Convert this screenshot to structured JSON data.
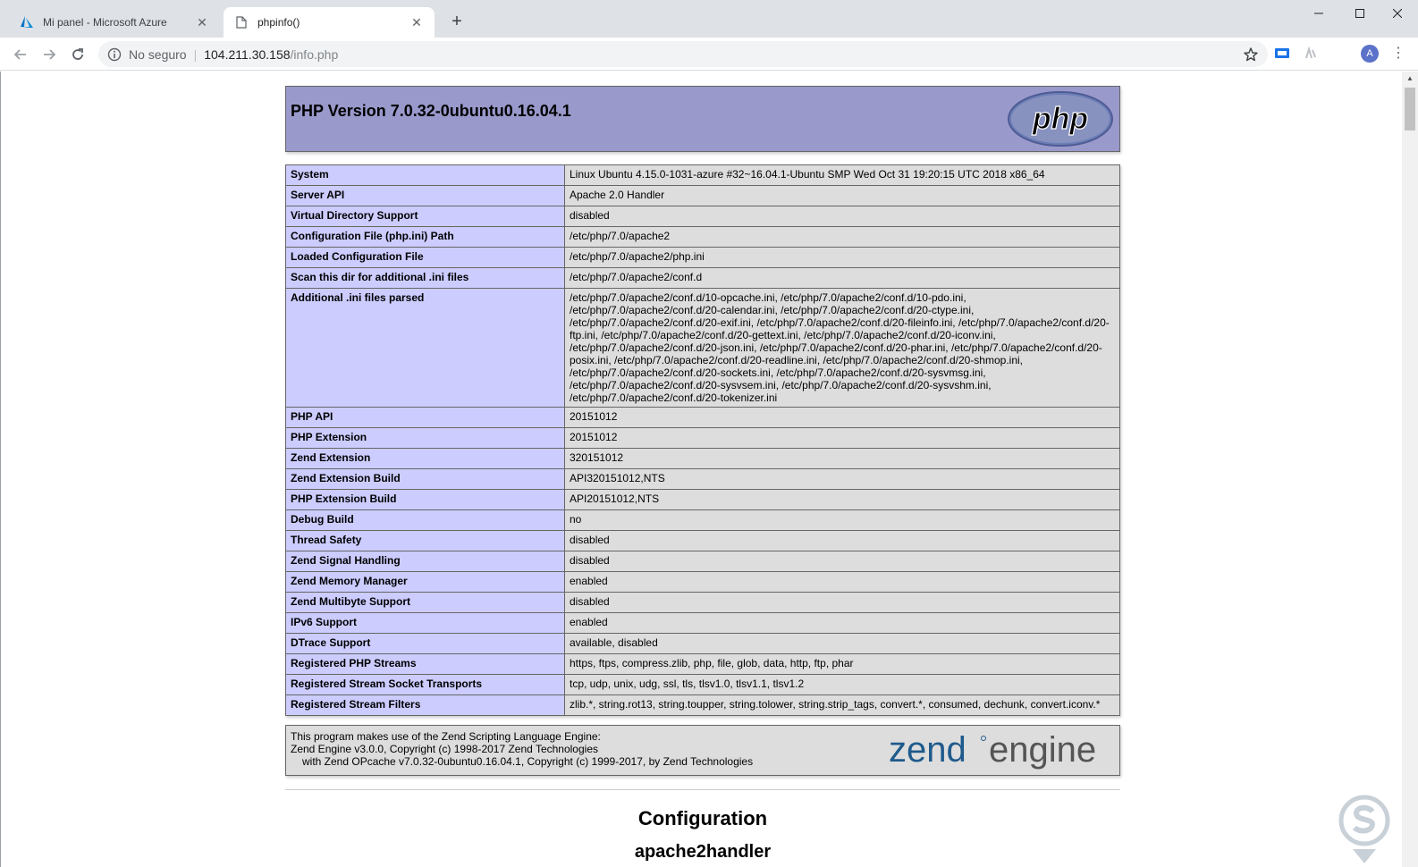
{
  "browser": {
    "tabs": [
      {
        "title": "Mi panel - Microsoft Azure",
        "icon": "azure-icon",
        "active": false
      },
      {
        "title": "phpinfo()",
        "icon": "page-icon",
        "active": true
      }
    ],
    "address": {
      "security": "No seguro",
      "host": "104.211.30.158",
      "path": "/info.php"
    },
    "avatar_letter": "A"
  },
  "php": {
    "version_title": "PHP Version 7.0.32-0ubuntu0.16.04.1",
    "logo_text": "php",
    "rows": [
      {
        "key": "System",
        "value": "Linux Ubuntu 4.15.0-1031-azure #32~16.04.1-Ubuntu SMP Wed Oct 31 19:20:15 UTC 2018 x86_64"
      },
      {
        "key": "Server API",
        "value": "Apache 2.0 Handler"
      },
      {
        "key": "Virtual Directory Support",
        "value": "disabled"
      },
      {
        "key": "Configuration File (php.ini) Path",
        "value": "/etc/php/7.0/apache2"
      },
      {
        "key": "Loaded Configuration File",
        "value": "/etc/php/7.0/apache2/php.ini"
      },
      {
        "key": "Scan this dir for additional .ini files",
        "value": "/etc/php/7.0/apache2/conf.d"
      },
      {
        "key": "Additional .ini files parsed",
        "value": "/etc/php/7.0/apache2/conf.d/10-opcache.ini, /etc/php/7.0/apache2/conf.d/10-pdo.ini, /etc/php/7.0/apache2/conf.d/20-calendar.ini, /etc/php/7.0/apache2/conf.d/20-ctype.ini, /etc/php/7.0/apache2/conf.d/20-exif.ini, /etc/php/7.0/apache2/conf.d/20-fileinfo.ini, /etc/php/7.0/apache2/conf.d/20-ftp.ini, /etc/php/7.0/apache2/conf.d/20-gettext.ini, /etc/php/7.0/apache2/conf.d/20-iconv.ini, /etc/php/7.0/apache2/conf.d/20-json.ini, /etc/php/7.0/apache2/conf.d/20-phar.ini, /etc/php/7.0/apache2/conf.d/20-posix.ini, /etc/php/7.0/apache2/conf.d/20-readline.ini, /etc/php/7.0/apache2/conf.d/20-shmop.ini, /etc/php/7.0/apache2/conf.d/20-sockets.ini, /etc/php/7.0/apache2/conf.d/20-sysvmsg.ini, /etc/php/7.0/apache2/conf.d/20-sysvsem.ini, /etc/php/7.0/apache2/conf.d/20-sysvshm.ini, /etc/php/7.0/apache2/conf.d/20-tokenizer.ini"
      },
      {
        "key": "PHP API",
        "value": "20151012"
      },
      {
        "key": "PHP Extension",
        "value": "20151012"
      },
      {
        "key": "Zend Extension",
        "value": "320151012"
      },
      {
        "key": "Zend Extension Build",
        "value": "API320151012,NTS"
      },
      {
        "key": "PHP Extension Build",
        "value": "API20151012,NTS"
      },
      {
        "key": "Debug Build",
        "value": "no"
      },
      {
        "key": "Thread Safety",
        "value": "disabled"
      },
      {
        "key": "Zend Signal Handling",
        "value": "disabled"
      },
      {
        "key": "Zend Memory Manager",
        "value": "enabled"
      },
      {
        "key": "Zend Multibyte Support",
        "value": "disabled"
      },
      {
        "key": "IPv6 Support",
        "value": "enabled"
      },
      {
        "key": "DTrace Support",
        "value": "available, disabled"
      },
      {
        "key": "Registered PHP Streams",
        "value": "https, ftps, compress.zlib, php, file, glob, data, http, ftp, phar"
      },
      {
        "key": "Registered Stream Socket Transports",
        "value": "tcp, udp, unix, udg, ssl, tls, tlsv1.0, tlsv1.1, tlsv1.2"
      },
      {
        "key": "Registered Stream Filters",
        "value": "zlib.*, string.rot13, string.toupper, string.tolower, string.strip_tags, convert.*, consumed, dechunk, convert.iconv.*"
      }
    ],
    "zend": {
      "line1": "This program makes use of the Zend Scripting Language Engine:",
      "line2": "Zend Engine v3.0.0, Copyright (c) 1998-2017 Zend Technologies",
      "line3": "with Zend OPcache v7.0.32-0ubuntu0.16.04.1, Copyright (c) 1999-2017, by Zend Technologies",
      "logo_word1": "zend",
      "logo_word2": "engine"
    },
    "configuration_heading": "Configuration",
    "module_heading": "apache2handler"
  },
  "colors": {
    "header_bg": "#9999cc",
    "key_bg": "#ccccff",
    "value_bg": "#dddddd",
    "zend_blue": "#1f5a8c",
    "zend_gray": "#555555"
  }
}
